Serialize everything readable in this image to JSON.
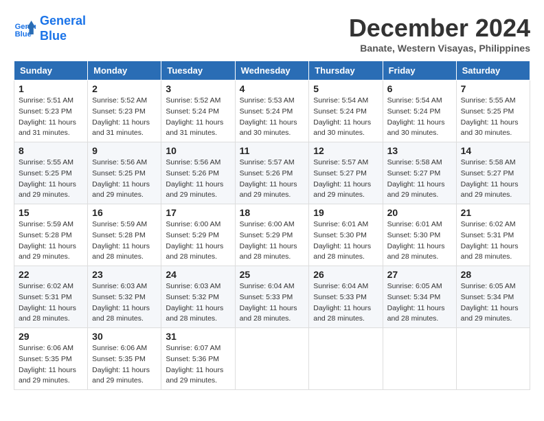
{
  "header": {
    "logo_line1": "General",
    "logo_line2": "Blue",
    "month": "December 2024",
    "location": "Banate, Western Visayas, Philippines"
  },
  "weekdays": [
    "Sunday",
    "Monday",
    "Tuesday",
    "Wednesday",
    "Thursday",
    "Friday",
    "Saturday"
  ],
  "weeks": [
    [
      {
        "day": "1",
        "sunrise": "5:51 AM",
        "sunset": "5:23 PM",
        "daylight": "11 hours and 31 minutes."
      },
      {
        "day": "2",
        "sunrise": "5:52 AM",
        "sunset": "5:23 PM",
        "daylight": "11 hours and 31 minutes."
      },
      {
        "day": "3",
        "sunrise": "5:52 AM",
        "sunset": "5:24 PM",
        "daylight": "11 hours and 31 minutes."
      },
      {
        "day": "4",
        "sunrise": "5:53 AM",
        "sunset": "5:24 PM",
        "daylight": "11 hours and 30 minutes."
      },
      {
        "day": "5",
        "sunrise": "5:54 AM",
        "sunset": "5:24 PM",
        "daylight": "11 hours and 30 minutes."
      },
      {
        "day": "6",
        "sunrise": "5:54 AM",
        "sunset": "5:24 PM",
        "daylight": "11 hours and 30 minutes."
      },
      {
        "day": "7",
        "sunrise": "5:55 AM",
        "sunset": "5:25 PM",
        "daylight": "11 hours and 30 minutes."
      }
    ],
    [
      {
        "day": "8",
        "sunrise": "5:55 AM",
        "sunset": "5:25 PM",
        "daylight": "11 hours and 29 minutes."
      },
      {
        "day": "9",
        "sunrise": "5:56 AM",
        "sunset": "5:25 PM",
        "daylight": "11 hours and 29 minutes."
      },
      {
        "day": "10",
        "sunrise": "5:56 AM",
        "sunset": "5:26 PM",
        "daylight": "11 hours and 29 minutes."
      },
      {
        "day": "11",
        "sunrise": "5:57 AM",
        "sunset": "5:26 PM",
        "daylight": "11 hours and 29 minutes."
      },
      {
        "day": "12",
        "sunrise": "5:57 AM",
        "sunset": "5:27 PM",
        "daylight": "11 hours and 29 minutes."
      },
      {
        "day": "13",
        "sunrise": "5:58 AM",
        "sunset": "5:27 PM",
        "daylight": "11 hours and 29 minutes."
      },
      {
        "day": "14",
        "sunrise": "5:58 AM",
        "sunset": "5:27 PM",
        "daylight": "11 hours and 29 minutes."
      }
    ],
    [
      {
        "day": "15",
        "sunrise": "5:59 AM",
        "sunset": "5:28 PM",
        "daylight": "11 hours and 29 minutes."
      },
      {
        "day": "16",
        "sunrise": "5:59 AM",
        "sunset": "5:28 PM",
        "daylight": "11 hours and 28 minutes."
      },
      {
        "day": "17",
        "sunrise": "6:00 AM",
        "sunset": "5:29 PM",
        "daylight": "11 hours and 28 minutes."
      },
      {
        "day": "18",
        "sunrise": "6:00 AM",
        "sunset": "5:29 PM",
        "daylight": "11 hours and 28 minutes."
      },
      {
        "day": "19",
        "sunrise": "6:01 AM",
        "sunset": "5:30 PM",
        "daylight": "11 hours and 28 minutes."
      },
      {
        "day": "20",
        "sunrise": "6:01 AM",
        "sunset": "5:30 PM",
        "daylight": "11 hours and 28 minutes."
      },
      {
        "day": "21",
        "sunrise": "6:02 AM",
        "sunset": "5:31 PM",
        "daylight": "11 hours and 28 minutes."
      }
    ],
    [
      {
        "day": "22",
        "sunrise": "6:02 AM",
        "sunset": "5:31 PM",
        "daylight": "11 hours and 28 minutes."
      },
      {
        "day": "23",
        "sunrise": "6:03 AM",
        "sunset": "5:32 PM",
        "daylight": "11 hours and 28 minutes."
      },
      {
        "day": "24",
        "sunrise": "6:03 AM",
        "sunset": "5:32 PM",
        "daylight": "11 hours and 28 minutes."
      },
      {
        "day": "25",
        "sunrise": "6:04 AM",
        "sunset": "5:33 PM",
        "daylight": "11 hours and 28 minutes."
      },
      {
        "day": "26",
        "sunrise": "6:04 AM",
        "sunset": "5:33 PM",
        "daylight": "11 hours and 28 minutes."
      },
      {
        "day": "27",
        "sunrise": "6:05 AM",
        "sunset": "5:34 PM",
        "daylight": "11 hours and 28 minutes."
      },
      {
        "day": "28",
        "sunrise": "6:05 AM",
        "sunset": "5:34 PM",
        "daylight": "11 hours and 29 minutes."
      }
    ],
    [
      {
        "day": "29",
        "sunrise": "6:06 AM",
        "sunset": "5:35 PM",
        "daylight": "11 hours and 29 minutes."
      },
      {
        "day": "30",
        "sunrise": "6:06 AM",
        "sunset": "5:35 PM",
        "daylight": "11 hours and 29 minutes."
      },
      {
        "day": "31",
        "sunrise": "6:07 AM",
        "sunset": "5:36 PM",
        "daylight": "11 hours and 29 minutes."
      },
      null,
      null,
      null,
      null
    ]
  ],
  "labels": {
    "sunrise": "Sunrise:",
    "sunset": "Sunset:",
    "daylight": "Daylight:"
  }
}
